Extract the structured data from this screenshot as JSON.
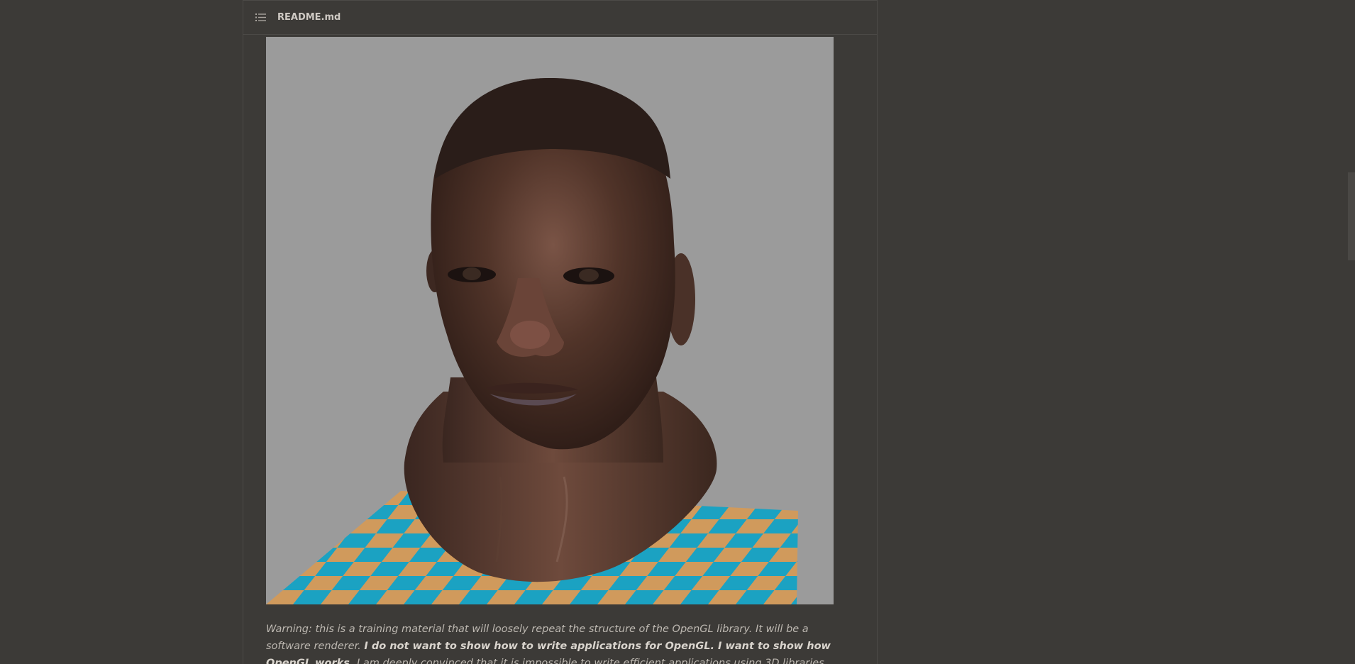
{
  "header": {
    "title": "README.md",
    "icon": "list-icon"
  },
  "image": {
    "alt": "Rendered 3D head model on checkerboard floor",
    "colors": {
      "background": "#9b9b9b",
      "checker_a": "#1ba2c2",
      "checker_b": "#d09a5c",
      "skin": "#4a3128"
    }
  },
  "note": {
    "part1": "Warning: this is a training material that will loosely repeat the structure of the OpenGL library. It will be a software renderer. ",
    "bold1": "I do not want to show how to write applications for OpenGL. I want to show how OpenGL works.",
    "part2": " I am deeply convinced that it is impossible to write efficient applications using 3D libraries without understanding this."
  }
}
